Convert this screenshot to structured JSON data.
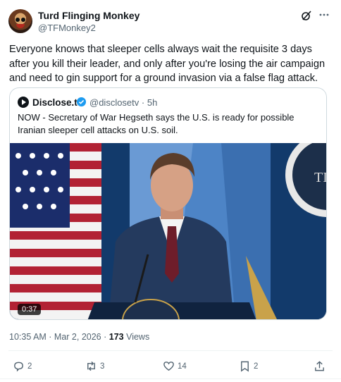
{
  "tweet": {
    "author_name": "Turd Flinging Monkey",
    "author_handle": "@TFMonkey2",
    "text": "Everyone knows that sleeper cells always wait the requisite 3 days after you kill their leader, and only after you're losing the air campaign and need to gin support for a ground invasion via a false flag attack.",
    "timestamp": "10:35 AM · Mar 2, 2026 · ",
    "views_count": "173",
    "views_label": " Views"
  },
  "quote": {
    "author_name": "Disclose.tv",
    "author_handle": "@disclosetv",
    "age": "· 5h",
    "text": "NOW - Secretary of War Hegseth says the U.S. is ready for possible Iranian sleeper cell attacks on U.S. soil.",
    "video_duration": "0:37"
  },
  "actions": {
    "replies": "2",
    "reposts": "3",
    "likes": "14",
    "bookmarks": "2"
  },
  "icons": {
    "header": [
      "grok-icon",
      "more-icon"
    ],
    "actions": [
      "reply-icon",
      "repost-icon",
      "like-icon",
      "bookmark-icon",
      "share-icon"
    ]
  },
  "colors": {
    "text": "#0f1419",
    "secondary": "#536471",
    "border": "#cfd9de",
    "verified": "#1d9bf0"
  }
}
